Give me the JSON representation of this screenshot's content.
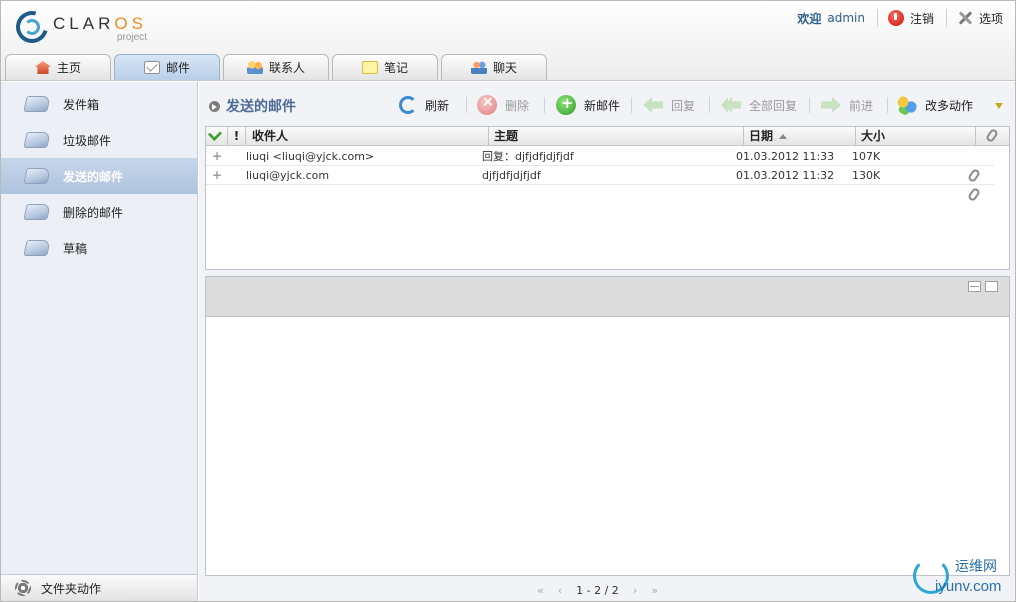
{
  "app": {
    "logo_text_a": "CLAR",
    "logo_text_b": "OS",
    "logo_sub": "project"
  },
  "topbar": {
    "welcome": "欢迎",
    "username": "admin",
    "logout": "注销",
    "options": "选项"
  },
  "tabs": [
    {
      "label": "主页",
      "icon": "home-icon"
    },
    {
      "label": "邮件",
      "icon": "mail-icon",
      "active": true
    },
    {
      "label": "联系人",
      "icon": "contacts-icon"
    },
    {
      "label": "笔记",
      "icon": "notes-icon"
    },
    {
      "label": "聊天",
      "icon": "chat-icon"
    }
  ],
  "sidebar": {
    "folders": [
      {
        "label": "发件箱"
      },
      {
        "label": "垃圾邮件"
      },
      {
        "label": "发送的邮件",
        "active": true
      },
      {
        "label": "删除的邮件"
      },
      {
        "label": "草稿"
      }
    ],
    "footer": "文件夹动作"
  },
  "toolbar": {
    "title": "发送的邮件",
    "refresh": "刷新",
    "delete": "删除",
    "new_mail": "新邮件",
    "reply": "回复",
    "reply_all": "全部回复",
    "forward": "前进",
    "more_actions": "改多动作"
  },
  "mail_list": {
    "headers": {
      "flags": "!",
      "recipient": "收件人",
      "subject": "主题",
      "date": "日期",
      "size": "大小"
    },
    "rows": [
      {
        "recipient": "liuqi <liuqi@yjck.com>",
        "subject": "回复：djfjdfjdjfjdf",
        "date": "01.03.2012 11:33",
        "size": "107K",
        "attachment": false
      },
      {
        "recipient": "liuqi@yjck.com",
        "subject": "djfjdfjdjfjdf",
        "date": "01.03.2012 11:32",
        "size": "130K",
        "attachment": true
      }
    ]
  },
  "pager": {
    "first": "«",
    "prev": "‹",
    "range": "1 - 2 / 2",
    "next": "›",
    "last": "»"
  },
  "watermark": {
    "line1": "运维网",
    "line2": "iyunv.com"
  },
  "colors": {
    "accent": "#4d6c95",
    "active_folder": "#aec3de",
    "active_tab": "#b9cfe8"
  }
}
